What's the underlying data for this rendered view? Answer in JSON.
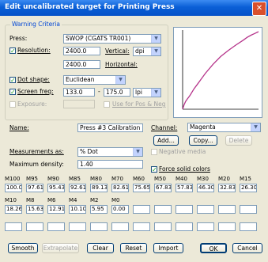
{
  "window": {
    "title": "Edit uncalibrated target for Printing Press",
    "close": "✕"
  },
  "warning": {
    "group_label": "Warning Criteria",
    "press_label": "Press:",
    "press_value": "SWOP (CGATS TR001)",
    "resolution_label": "Resolution:",
    "resolution_value": "2400.0",
    "vertical_label": "Vertical:",
    "unit_value": "dpi",
    "horizontal_value": "2400.0",
    "horizontal_label": "Horizontal:",
    "dot_shape_label": "Dot shape:",
    "dot_shape_value": "Euclidean",
    "screen_freq_label": "Screen freq:",
    "screen_freq_value": "133.0",
    "screen_freq_sep": "-",
    "screen_freq_value2": "175.0",
    "screen_unit": "lpi",
    "exposure_label": "Exposure:",
    "use_pos_neg_label": "Use for Pos & Neg"
  },
  "form": {
    "name_label": "Name:",
    "name_value": "Press #3 Calibration",
    "channel_label": "Channel:",
    "channel_value": "Magenta",
    "add_button": "Add...",
    "copy_button": "Copy...",
    "delete_button": "Delete",
    "measurements_label": "Measurements as:",
    "measurements_value": "% Dot",
    "negative_media_label": "Negative media",
    "max_density_label": "Maximum density:",
    "max_density_value": "1.40",
    "force_solid_label": "Force solid colors"
  },
  "table": {
    "row1_headers": [
      "M100",
      "M95",
      "M90",
      "M85",
      "M80",
      "M70",
      "M60",
      "M50",
      "M40",
      "M30",
      "M20",
      "M15"
    ],
    "row1_values": [
      "100.00",
      "97.61",
      "95.43",
      "92.61",
      "89.13",
      "82.61",
      "75.65",
      "67.83",
      "57.83",
      "46.30",
      "32.83",
      "26.30"
    ],
    "row2_headers": [
      "M10",
      "M8",
      "M6",
      "M4",
      "M2",
      "M0"
    ],
    "row2_values": [
      "18.26",
      "15.63",
      "12.91",
      "10.10",
      "5.95",
      "0.00"
    ]
  },
  "buttons": {
    "smooth": "Smooth",
    "extrapolate": "Extrapolate",
    "clear": "Clear",
    "reset": "Reset",
    "import": "Import",
    "ok": "OK",
    "cancel": "Cancel"
  },
  "curve": {
    "color": "#b5338a",
    "points": [
      [
        0,
        0
      ],
      [
        2,
        5.95
      ],
      [
        4,
        10.1
      ],
      [
        6,
        12.91
      ],
      [
        8,
        15.63
      ],
      [
        10,
        18.26
      ],
      [
        15,
        26.3
      ],
      [
        20,
        32.83
      ],
      [
        30,
        46.3
      ],
      [
        40,
        57.83
      ],
      [
        50,
        67.83
      ],
      [
        60,
        75.65
      ],
      [
        70,
        82.61
      ],
      [
        80,
        89.13
      ],
      [
        85,
        92.61
      ],
      [
        90,
        95.43
      ],
      [
        95,
        97.61
      ],
      [
        100,
        100
      ]
    ]
  }
}
